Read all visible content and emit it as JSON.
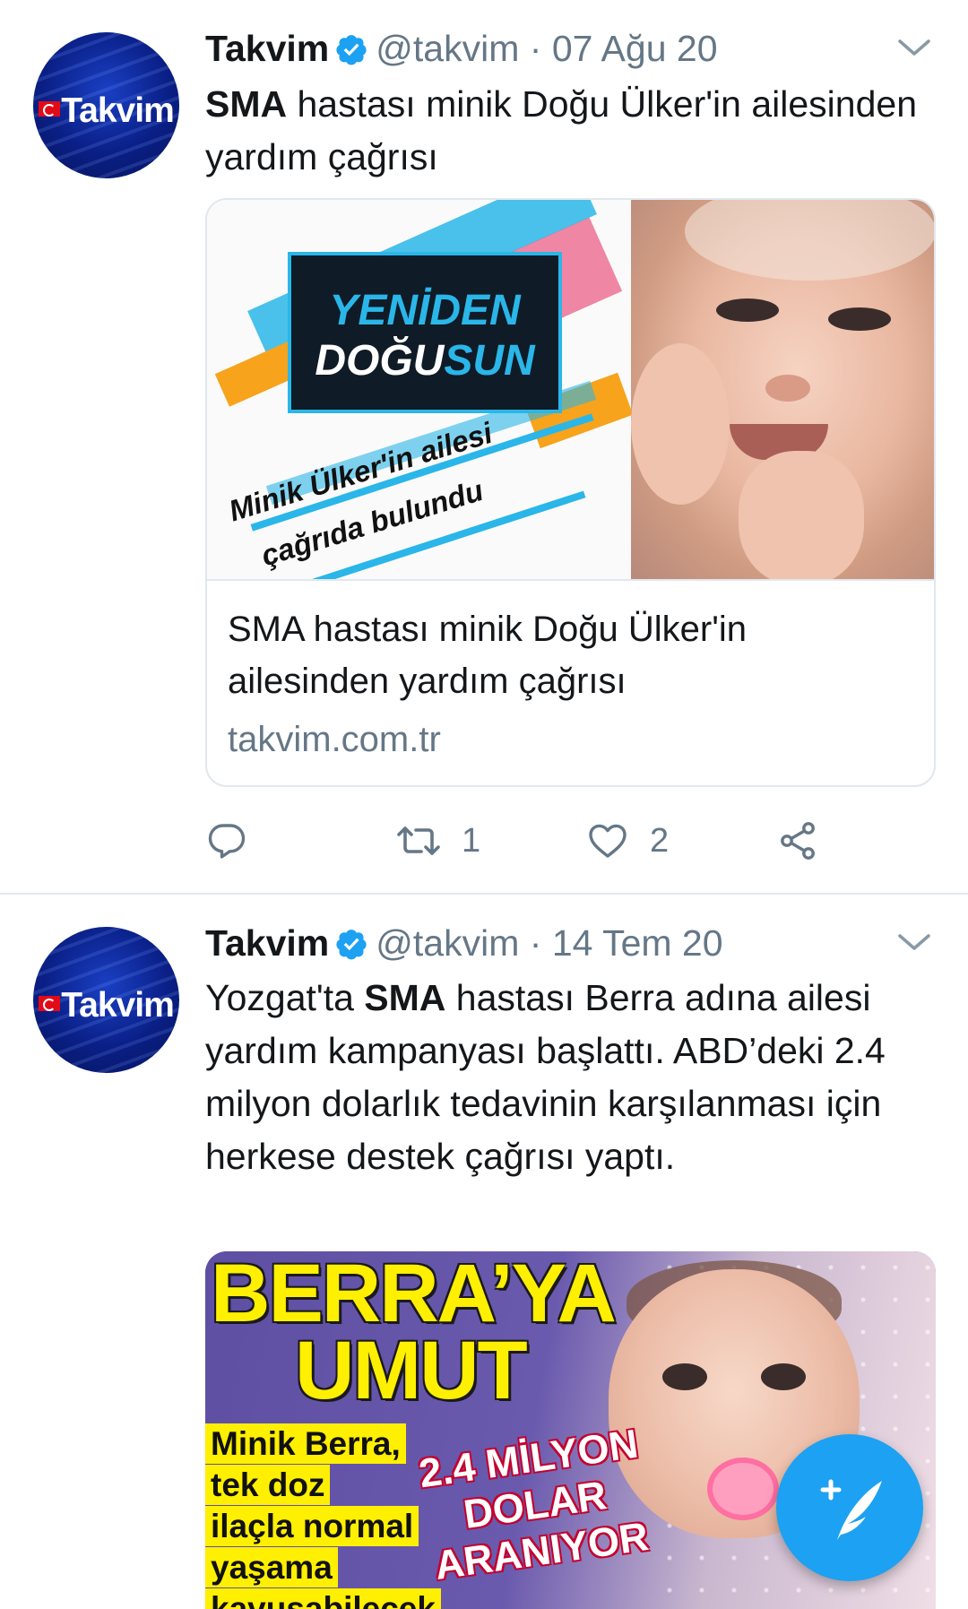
{
  "tweets": [
    {
      "author": "Takvim",
      "handle": "@takvim",
      "separator": "·",
      "date": "07 Ağu 20",
      "avatar_logo": "Takvim",
      "text_bold": "SMA",
      "text_rest": " hastası minik Doğu Ülker'in ailesinden yardım çağrısı",
      "card": {
        "image_sign_line1": "YENİDEN",
        "image_sign_line2_a": "DOĞU",
        "image_sign_line2_b": "SUN",
        "image_caption_line1": "Minik Ülker'in ailesi",
        "image_caption_line2": "çağrıda bulundu",
        "title": "SMA hastası minik Doğu Ülker'in ailesinden yardım çağrısı",
        "domain": "takvim.com.tr"
      },
      "actions": {
        "reply_icon": "reply-icon",
        "retweet_icon": "retweet-icon",
        "retweet_count": "1",
        "like_icon": "heart-icon",
        "like_count": "2",
        "share_icon": "share-icon"
      }
    },
    {
      "author": "Takvim",
      "handle": "@takvim",
      "separator": "·",
      "date": "14 Tem 20",
      "avatar_logo": "Takvim",
      "text_pre": "Yozgat'ta ",
      "text_bold": "SMA",
      "text_rest": " hastası Berra adına ailesi yardım kampanyası başlattı. ABD’deki 2.4 milyon dolarlık tedavinin karşılanması için herkese destek çağrısı yaptı.",
      "image": {
        "headline_line1": "BERRA’YA",
        "headline_line2": "UMUT",
        "box_lines": [
          "Minik Berra,",
          "tek doz",
          "ilaçla normal",
          "yaşama",
          "kavuşabilecek"
        ],
        "amount_line1": "2.4 MİLYON",
        "amount_line2": "DOLAR",
        "amount_line3": "ARANIYOR"
      }
    }
  ],
  "fab": {
    "icon": "compose-tweet-icon"
  },
  "colors": {
    "accent": "#1da1f2",
    "text": "#14171a",
    "secondary_text": "#657786",
    "border": "#e1e8ed"
  }
}
